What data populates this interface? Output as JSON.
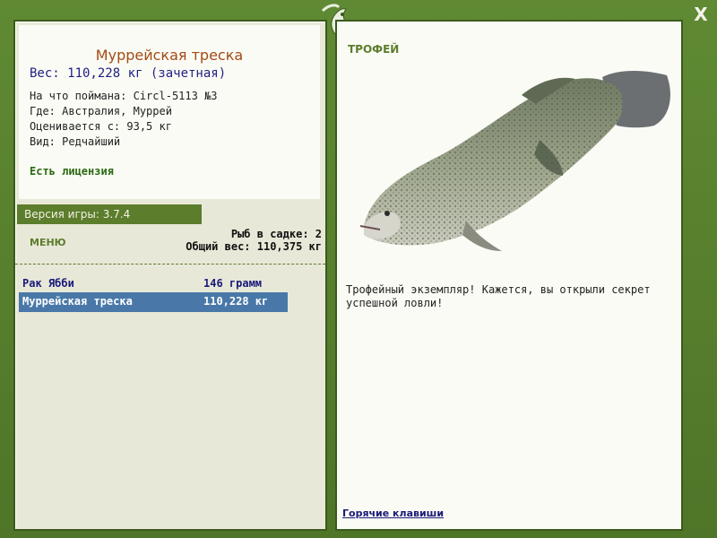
{
  "window": {
    "close_label": "X"
  },
  "details": {
    "fish_name": "Муррейская треска",
    "weight": "Вес: 110,228 кг (зачетная)",
    "caught_on": "На что поймана: Circl-5113 №3",
    "location": "Где: Австралия, Муррей",
    "value": "Оценивается с: 93,5 кг",
    "rarity": "Вид: Редчайший",
    "license": "Есть лицензия"
  },
  "version_label": "Версия игры: 3.7.4",
  "menu_label": "МЕНЮ",
  "keepnet": {
    "count": "Рыб в садке: 2",
    "total_weight": "Общий вес: 110,375 кг"
  },
  "catch_list": [
    {
      "name": "Рак Ябби",
      "weight": "146 грамм",
      "selected": false
    },
    {
      "name": "Муррейская треска",
      "weight": "110,228 кг",
      "selected": true
    }
  ],
  "trophy_panel": {
    "label": "ТРОФЕЙ",
    "description": "Трофейный экземпляр! Кажется, вы открыли секрет успешной ловли!",
    "hotkeys_label": "Горячие клавиши"
  },
  "icons": {
    "logo": "fish-logo-icon",
    "close": "close-icon"
  },
  "colors": {
    "frame_green": "#557a2c",
    "accent_green": "#5c7d2c",
    "fish_name_color": "#a24a13",
    "selection_blue": "#4978a8"
  }
}
